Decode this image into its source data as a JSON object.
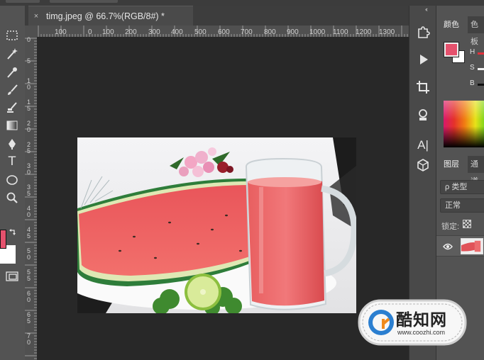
{
  "document": {
    "tab_title": "timg.jpeg @ 66.7%(RGB/8#) *",
    "close_glyph": "×"
  },
  "rulers": {
    "top_labels": [
      "100",
      "0",
      "100",
      "200",
      "300",
      "400",
      "500",
      "600",
      "700",
      "800",
      "900",
      "1000",
      "1100",
      "1200",
      "1300"
    ],
    "left_labels": [
      "0",
      "5",
      "1 0",
      "1 5",
      "2 0",
      "2 5",
      "3 0",
      "3 5",
      "4 0",
      "4 5",
      "5 0",
      "5 5",
      "6 0",
      "6 5",
      "7 0"
    ]
  },
  "toolbar": {
    "tools": [
      "marquee-icon",
      "magic-wand-icon",
      "eyedropper-icon",
      "brush-icon",
      "clone-stamp-icon",
      "gradient-icon",
      "pen-icon",
      "type-icon",
      "ellipse-icon",
      "zoom-icon"
    ],
    "type_glyph": "T",
    "foreground_color": "#e5516d",
    "background_color": "#ffffff"
  },
  "dock": {
    "collapse_glyph": "‹‹",
    "buttons": [
      "puzzle-icon",
      "play-icon",
      "crop-icon",
      "stamp-icon",
      "type-panel-icon",
      "cube-icon"
    ],
    "type_panel_label": "A|"
  },
  "panels": {
    "color_tabs": [
      "颜色",
      "色板"
    ],
    "hsb_labels": [
      "H",
      "S",
      "B"
    ],
    "layer_tabs": [
      "图层",
      "通道"
    ],
    "filter_placeholder": "ρ 类型",
    "blend_mode": "正常",
    "lock_label": "锁定:"
  },
  "watermark": {
    "brand": "酷知网",
    "url": "www.coozhi.com"
  }
}
